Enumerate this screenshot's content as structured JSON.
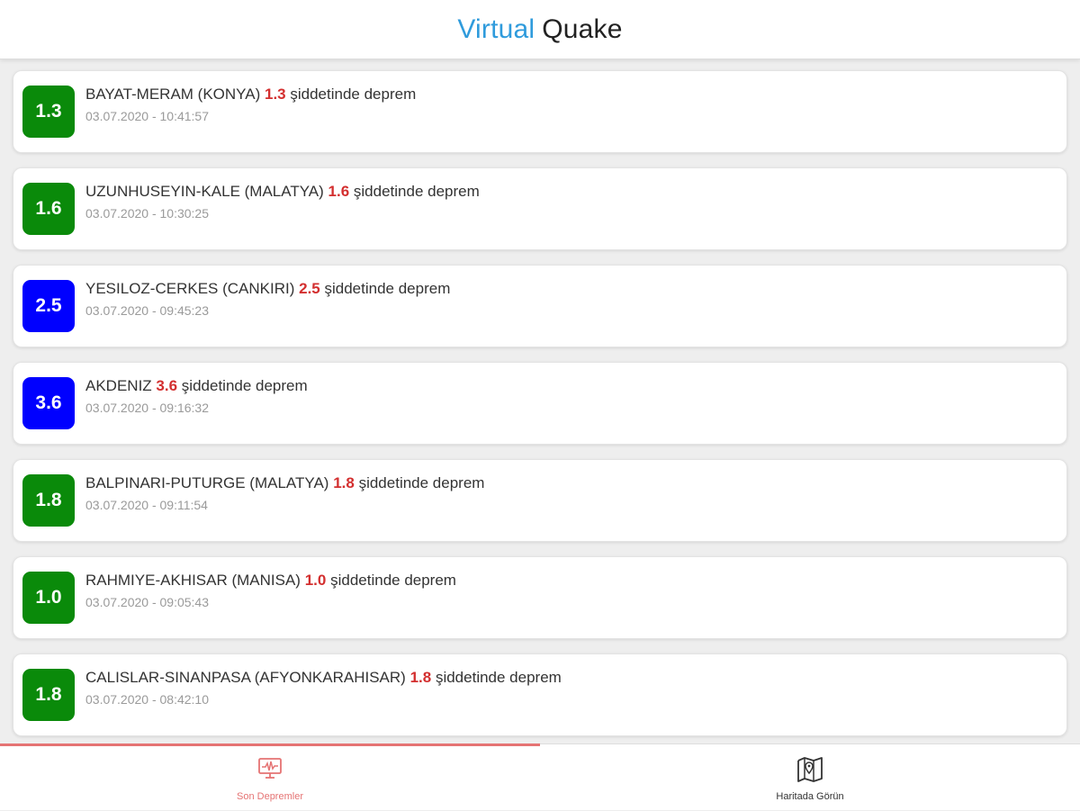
{
  "header": {
    "title_part1": "Virtual",
    "title_part2": "Quake"
  },
  "colors": {
    "title_accent": "#2f9bdc",
    "badge_green": "#0a8a0a",
    "badge_blue": "#0000ff",
    "magnitude_text": "#d32f2f",
    "active_tab": "#e57373"
  },
  "quakes": [
    {
      "location": "BAYAT-MERAM (KONYA)",
      "magnitude": "1.3",
      "suffix": "şiddetinde deprem",
      "datetime": "03.07.2020 - 10:41:57",
      "badge_color": "#0a8a0a"
    },
    {
      "location": "UZUNHUSEYIN-KALE (MALATYA)",
      "magnitude": "1.6",
      "suffix": "şiddetinde deprem",
      "datetime": "03.07.2020 - 10:30:25",
      "badge_color": "#0a8a0a"
    },
    {
      "location": "YESILOZ-CERKES (CANKIRI)",
      "magnitude": "2.5",
      "suffix": "şiddetinde deprem",
      "datetime": "03.07.2020 - 09:45:23",
      "badge_color": "#0000ff"
    },
    {
      "location": "AKDENIZ",
      "magnitude": "3.6",
      "suffix": "şiddetinde deprem",
      "datetime": "03.07.2020 - 09:16:32",
      "badge_color": "#0000ff"
    },
    {
      "location": "BALPINARI-PUTURGE (MALATYA)",
      "magnitude": "1.8",
      "suffix": "şiddetinde deprem",
      "datetime": "03.07.2020 - 09:11:54",
      "badge_color": "#0a8a0a"
    },
    {
      "location": "RAHMIYE-AKHISAR (MANISA)",
      "magnitude": "1.0",
      "suffix": "şiddetinde deprem",
      "datetime": "03.07.2020 - 09:05:43",
      "badge_color": "#0a8a0a"
    },
    {
      "location": "CALISLAR-SINANPASA (AFYONKARAHISAR)",
      "magnitude": "1.8",
      "suffix": "şiddetinde deprem",
      "datetime": "03.07.2020 - 08:42:10",
      "badge_color": "#0a8a0a"
    }
  ],
  "nav": {
    "tabs": [
      {
        "label": "Son Depremler",
        "icon": "monitor-waveform-icon",
        "active": true
      },
      {
        "label": "Haritada Görün",
        "icon": "map-pin-icon",
        "active": false
      }
    ]
  }
}
